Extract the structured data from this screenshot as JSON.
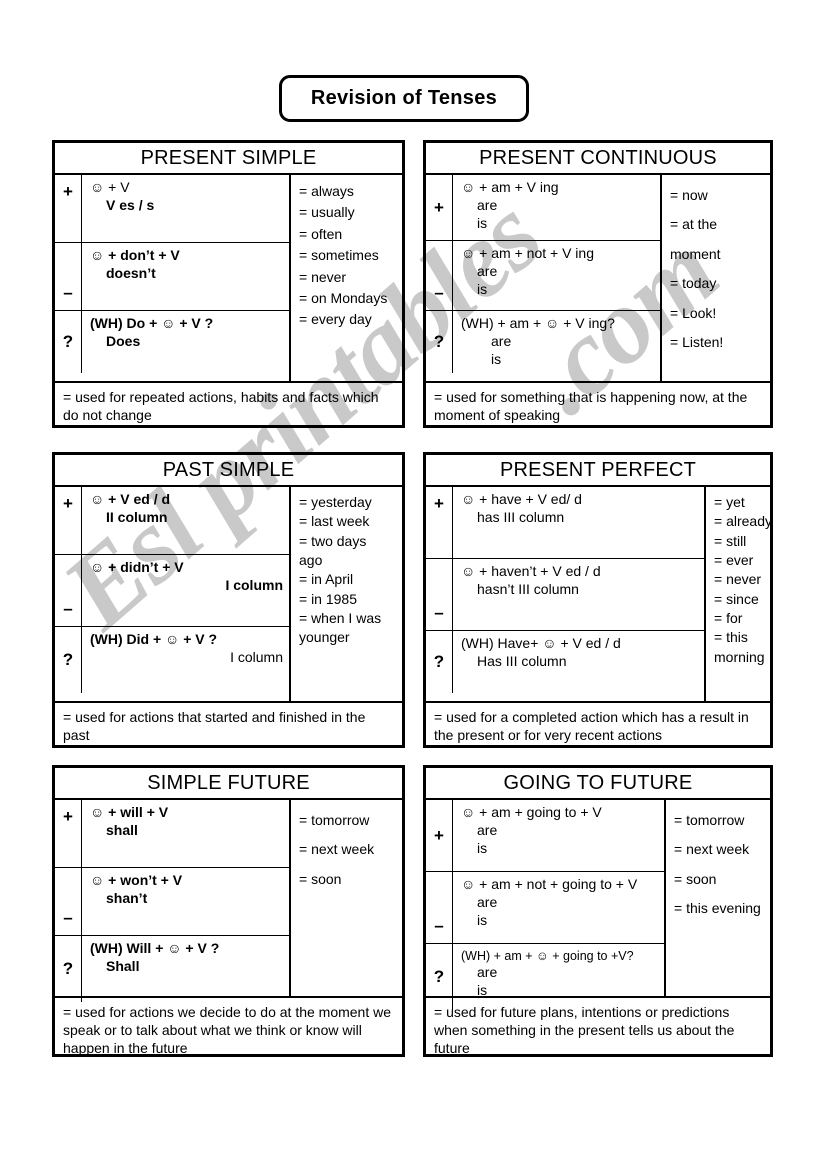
{
  "document": {
    "title": "Revision of Tenses",
    "watermark_main": "Esl printables",
    "watermark_domain": ".com",
    "subject_icon": "smiley-face-icon"
  },
  "tenses": [
    {
      "name": "PRESENT SIMPLE",
      "rows": [
        {
          "symbol": "+",
          "symbol_align": "top",
          "lines": [
            {
              "text": "☺  +  V",
              "style": "underline-last",
              "indent": 0
            },
            {
              "text": "V es / s",
              "style": "bold",
              "indent": 1
            }
          ]
        },
        {
          "symbol": "–",
          "symbol_align": "bottom",
          "lines": [
            {
              "text": "☺  +  don’t  +  V",
              "style": "bold",
              "indent": 0
            },
            {
              "text": "doesn’t",
              "style": "bold",
              "indent": 1
            }
          ]
        },
        {
          "symbol": "?",
          "symbol_align": "mid",
          "lines": [
            {
              "text": "(WH)  Do  +  ☺ + V ?",
              "style": "bold",
              "indent": 0
            },
            {
              "text": "Does",
              "style": "bold",
              "indent": 1
            }
          ]
        }
      ],
      "time_expressions": [
        "= always",
        "= usually",
        "= often",
        "= sometimes",
        "= never",
        "= on Mondays",
        "= every day"
      ],
      "usage": "= used for repeated actions, habits and facts which do not change"
    },
    {
      "name": "PRESENT CONTINUOUS",
      "rows": [
        {
          "symbol": "+",
          "symbol_align": "mid",
          "lines": [
            {
              "text": "☺ + am + V ing",
              "indent": 0
            },
            {
              "text": "are",
              "indent": 1
            },
            {
              "text": "is",
              "indent": 1
            }
          ]
        },
        {
          "symbol": "–",
          "symbol_align": "bottom",
          "lines": [
            {
              "text": "☺ + am  +  not  +  V ing",
              "indent": 0
            },
            {
              "text": "are",
              "indent": 1
            },
            {
              "text": "is",
              "indent": 1
            }
          ]
        },
        {
          "symbol": "?",
          "symbol_align": "mid",
          "lines": [
            {
              "text": "(WH) + am +  ☺  + V ing?",
              "indent": 0
            },
            {
              "text": "are",
              "indent": 2
            },
            {
              "text": "is",
              "indent": 2
            }
          ]
        }
      ],
      "time_expressions": [
        "= now",
        "= at the",
        "moment",
        "= today",
        "= Look!",
        "= Listen!"
      ],
      "usage": "= used for something that is happening now, at the moment of speaking"
    },
    {
      "name": "PAST SIMPLE",
      "rows": [
        {
          "symbol": "+",
          "symbol_align": "top",
          "lines": [
            {
              "text": "☺ + V ed / d",
              "style": "bold",
              "indent": 0
            },
            {
              "text": "II column",
              "style": "bold",
              "indent": 1
            }
          ]
        },
        {
          "symbol": "–",
          "symbol_align": "bottom",
          "lines": [
            {
              "text": "☺  +  didn’t + V",
              "style": "bold",
              "indent": 0
            },
            {
              "text": "I column",
              "style": "bold-right",
              "indent": 0
            }
          ]
        },
        {
          "symbol": "?",
          "symbol_align": "mid",
          "lines": [
            {
              "text": "(WH) Did + ☺ + V ?",
              "style": "bold",
              "indent": 0
            },
            {
              "text": "I column",
              "style": "right",
              "indent": 0
            }
          ]
        }
      ],
      "time_expressions": [
        "= yesterday",
        "= last week",
        "= two days",
        "ago",
        "= in April",
        "= in 1985",
        "= when I was",
        "younger"
      ],
      "usage": "= used for actions that started and finished in the past"
    },
    {
      "name": "PRESENT PERFECT",
      "rows": [
        {
          "symbol": "+",
          "symbol_align": "top",
          "lines": [
            {
              "text": "☺  +  have +    V ed/ d",
              "indent": 0
            },
            {
              "text": "has        III column",
              "indent": 1
            }
          ]
        },
        {
          "symbol": "–",
          "symbol_align": "bottom",
          "lines": [
            {
              "text": "☺  +  haven’t +   V ed / d",
              "indent": 0
            },
            {
              "text": "hasn’t        III column",
              "indent": 1
            }
          ]
        },
        {
          "symbol": "?",
          "symbol_align": "mid",
          "lines": [
            {
              "text": "(WH) Have+  ☺ +  V ed / d",
              "indent": 0
            },
            {
              "text": "Has          III column",
              "indent": 1
            }
          ]
        }
      ],
      "time_expressions": [
        "= yet",
        "= already",
        "= still",
        "= ever",
        "= never",
        "= since",
        "= for",
        "= this",
        "morning"
      ],
      "usage": "= used for a completed action which has a result in the present or for very recent actions"
    },
    {
      "name": "SIMPLE FUTURE",
      "rows": [
        {
          "symbol": "+",
          "symbol_align": "top",
          "lines": [
            {
              "text": "☺   +  will   +  V",
              "style": "bold",
              "indent": 0
            },
            {
              "text": "shall",
              "style": "bold",
              "indent": 1
            }
          ]
        },
        {
          "symbol": "–",
          "symbol_align": "bottom",
          "lines": [
            {
              "text": "☺   +  won’t   +  V",
              "style": "bold",
              "indent": 0
            },
            {
              "text": "shan’t",
              "style": "bold",
              "indent": 1
            }
          ]
        },
        {
          "symbol": "?",
          "symbol_align": "mid",
          "lines": [
            {
              "text": "(WH) Will +  ☺  + V ?",
              "style": "bold",
              "indent": 0
            },
            {
              "text": "Shall",
              "style": "bold",
              "indent": 1
            }
          ]
        }
      ],
      "time_expressions": [
        "= tomorrow",
        "= next week",
        "= soon"
      ],
      "usage": "= used for actions we decide to do at the moment we speak or to talk about what we think or know will happen in the  future"
    },
    {
      "name": "GOING TO FUTURE",
      "rows": [
        {
          "symbol": "+",
          "symbol_align": "mid",
          "lines": [
            {
              "text": "☺ + am + going to + V",
              "indent": 0
            },
            {
              "text": "are",
              "indent": 1
            },
            {
              "text": "is",
              "indent": 1
            }
          ]
        },
        {
          "symbol": "–",
          "symbol_align": "bottom",
          "lines": [
            {
              "text": "☺ + am + not + going to + V",
              "indent": 0
            },
            {
              "text": "are",
              "indent": 1
            },
            {
              "text": "is",
              "indent": 1
            }
          ]
        },
        {
          "symbol": "?",
          "symbol_align": "mid",
          "lines": [
            {
              "text": "(WH) + am + ☺  + going to +V?",
              "style": "small",
              "indent": 0
            },
            {
              "text": "are",
              "indent": 1
            },
            {
              "text": "is",
              "indent": 1
            }
          ]
        }
      ],
      "time_expressions": [
        "= tomorrow",
        "= next week",
        "= soon",
        "= this evening"
      ],
      "usage": "= used for future plans, intentions or predictions when something in the present tells us about the future"
    }
  ]
}
